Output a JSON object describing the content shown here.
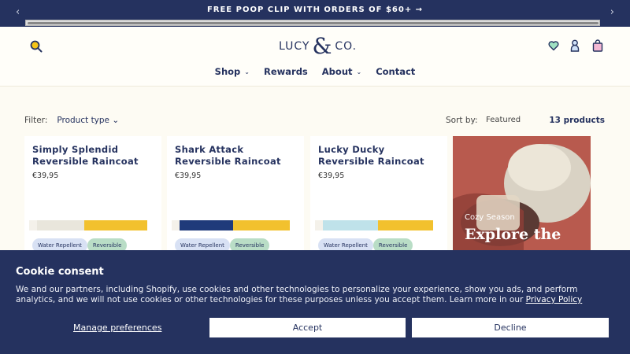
{
  "announcement": {
    "prev": "‹",
    "next": "›",
    "text": "FREE POOP CLIP WITH ORDERS OF $60+ →"
  },
  "header": {
    "logo_left": "LUCY",
    "logo_amp": "&",
    "logo_right": "CO.",
    "icons": [
      "search-icon",
      "heart-icon",
      "account-icon",
      "bag-icon"
    ]
  },
  "nav": {
    "shop": "Shop",
    "rewards": "Rewards",
    "about": "About",
    "contact": "Contact",
    "chevron": "⌄"
  },
  "toolbar": {
    "filter_label": "Filter:",
    "product_type": "Product type ⌄",
    "sort_label": "Sort by:",
    "sort_value": "Featured",
    "count": "13 products"
  },
  "products": [
    {
      "title": "Simply Splendid Reversible Raincoat",
      "price": "€39,95",
      "tag1": "Water Repellent",
      "tag2": "Reversible",
      "colors": [
        "#e9e6dc",
        "#f2c12e"
      ]
    },
    {
      "title": "Shark Attack Reversible Raincoat",
      "price": "€39,95",
      "tag1": "Water Repellent",
      "tag2": "Reversible",
      "colors": [
        "#1f3a7a",
        "#f2c12e"
      ]
    },
    {
      "title": "Lucky Ducky Reversible Raincoat",
      "price": "€39,95",
      "tag1": "Water Repellent",
      "tag2": "Reversible",
      "colors": [
        "#bfe2ea",
        "#f2c12e"
      ]
    }
  ],
  "promo": {
    "sub": "Cozy Season",
    "head": "Explore the"
  },
  "cookie": {
    "title": "Cookie consent",
    "body": "We and our partners, including Shopify, use cookies and other technologies to personalize your experience, show you ads, and perform analytics, and we will not use cookies or other technologies for these purposes unless you accept them. Learn more in our ",
    "link": "Privacy Policy",
    "manage": "Manage preferences",
    "accept": "Accept",
    "decline": "Decline"
  }
}
